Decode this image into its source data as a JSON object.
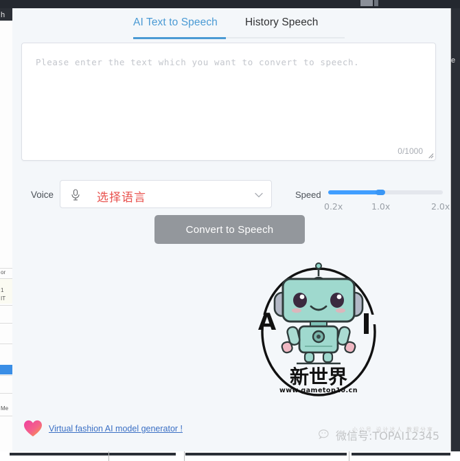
{
  "window": {
    "background_app_fragment_top": "h",
    "background_app_fragments": [
      "or",
      "1",
      "IT",
      "Me"
    ],
    "right_edge_fragment": "e"
  },
  "tabs": [
    {
      "label": "AI Text to Speech",
      "active": true
    },
    {
      "label": "History Speech",
      "active": false
    }
  ],
  "editor": {
    "placeholder": "Please enter the text which you want to convert to speech.",
    "value": "",
    "counter": "0/1000",
    "max_chars": 1000
  },
  "voice": {
    "label": "Voice",
    "selected": "选择语言",
    "icon": "microphone-icon",
    "chevron": "chevron-down-icon",
    "value_color": "#e8514d"
  },
  "speed": {
    "label": "Speed",
    "ticks": [
      "0.2x",
      "1.0x",
      "2.0x"
    ],
    "value": "1.0x",
    "fill_percent": 45,
    "accent_color": "#409eff",
    "track_color": "#e4e7ed"
  },
  "actions": {
    "convert_label": "Convert to Speech",
    "convert_disabled": true,
    "convert_color": "#93979c"
  },
  "logo": {
    "letter_left": "A",
    "letter_right": "I",
    "title_cn": "新世界",
    "url": "www.gametop10.cn",
    "body_color": "#8fd4c8",
    "outline_color": "#1a1a1a"
  },
  "footer": {
    "link_text": "Virtual fashion AI model generator !",
    "link_color": "#3a6fc4",
    "icon": "heart-icon"
  },
  "watermark": {
    "text": "微信号:TOPAI12345",
    "ghost_text": "小公号 设计达人 教程分享",
    "icon": "wechat-icon"
  }
}
